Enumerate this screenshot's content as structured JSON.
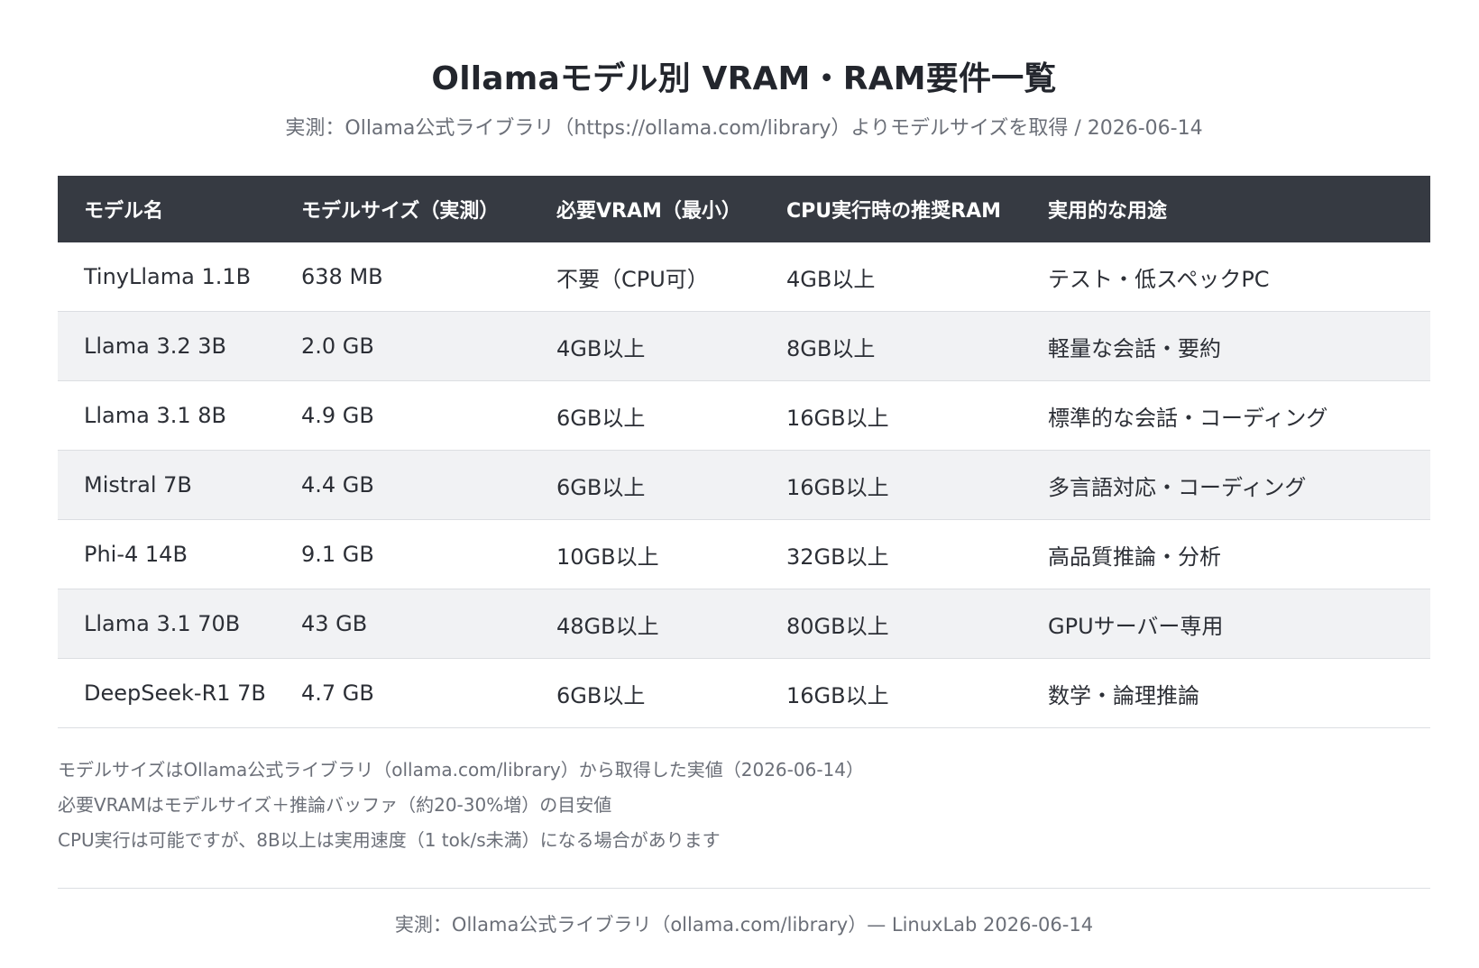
{
  "header": {
    "title": "Ollamaモデル別 VRAM・RAM要件一覧",
    "subtitle": "実測：Ollama公式ライブラリ（https://ollama.com/library）よりモデルサイズを取得 / 2026-06-14"
  },
  "table": {
    "columns": [
      "モデル名",
      "モデルサイズ（実測）",
      "必要VRAM（最小）",
      "CPU実行時の推奨RAM",
      "実用的な用途"
    ],
    "rows": [
      [
        "TinyLlama 1.1B",
        "638 MB",
        "不要（CPU可）",
        "4GB以上",
        "テスト・低スペックPC"
      ],
      [
        "Llama 3.2 3B",
        "2.0 GB",
        "4GB以上",
        "8GB以上",
        "軽量な会話・要約"
      ],
      [
        "Llama 3.1 8B",
        "4.9 GB",
        "6GB以上",
        "16GB以上",
        "標準的な会話・コーディング"
      ],
      [
        "Mistral 7B",
        "4.4 GB",
        "6GB以上",
        "16GB以上",
        "多言語対応・コーディング"
      ],
      [
        "Phi-4 14B",
        "9.1 GB",
        "10GB以上",
        "32GB以上",
        "高品質推論・分析"
      ],
      [
        "Llama 3.1 70B",
        "43 GB",
        "48GB以上",
        "80GB以上",
        "GPUサーバー専用"
      ],
      [
        "DeepSeek-R1 7B",
        "4.7 GB",
        "6GB以上",
        "16GB以上",
        "数学・論理推論"
      ]
    ]
  },
  "notes": [
    "モデルサイズはOllama公式ライブラリ（ollama.com/library）から取得した実値（2026-06-14）",
    "必要VRAMはモデルサイズ＋推論バッファ（約20-30%増）の目安値",
    "CPU実行は可能ですが、8B以上は実用速度（1 tok/s未満）になる場合があります"
  ],
  "footer": {
    "source": "実測：Ollama公式ライブラリ（ollama.com/library）— LinuxLab 2026-06-14"
  },
  "colors": {
    "header_bg": "#363a42",
    "row_alt_bg": "#f1f2f4",
    "text": "#2c2f36",
    "muted": "#6b6f78"
  }
}
